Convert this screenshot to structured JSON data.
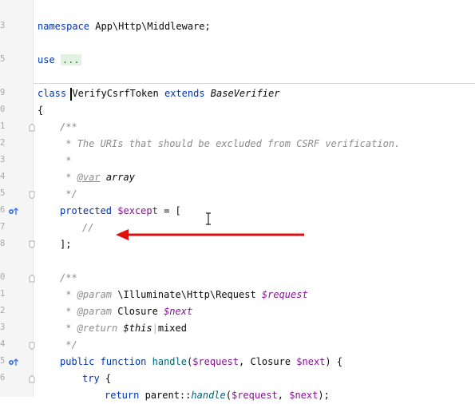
{
  "gutter": {
    "line_numbers": [
      "3",
      "",
      "5",
      "",
      "",
      "",
      "9",
      "0",
      "1",
      "2",
      "3",
      "4",
      "5",
      "6",
      "7",
      "8",
      "",
      "0",
      "1",
      "2",
      "3",
      "4",
      "5",
      "6"
    ]
  },
  "code": {
    "l_namespace_kw": "namespace",
    "l_namespace_path": "App\\Http\\Middleware;",
    "l_use_kw": "use",
    "l_use_fold": "...",
    "l_class_kw": "class",
    "l_class_name": "VerifyCsrfToken",
    "l_extends_kw": "extends",
    "l_base": "BaseVerifier",
    "l_open_brace": "{",
    "l_doc_open": "/**",
    "l_doc_desc": " * The URIs that should be excluded from CSRF verification.",
    "l_doc_star": " *",
    "l_doc_var_star": " * ",
    "l_doc_var_tag": "@var",
    "l_doc_var_type": " array",
    "l_doc_close": " */",
    "l_protected_kw": "protected",
    "l_except_var": "$except",
    "l_except_rest": " = [",
    "l_comment": "//",
    "l_close_arr": "];",
    "l_doc2_open": "/**",
    "l_param1_star": " * ",
    "l_param1_tag": "@param",
    "l_param1_type": " \\Illuminate\\Http\\Request ",
    "l_param1_var": "$request",
    "l_param2_star": " * ",
    "l_param2_tag": "@param",
    "l_param2_type": " Closure ",
    "l_param2_var": "$next",
    "l_return_star": " * ",
    "l_return_tag": "@return",
    "l_return_this": " $this",
    "l_return_pipe": "|",
    "l_return_mixed": "mixed",
    "l_doc2_close": " */",
    "l_public_kw": "public",
    "l_function_kw": "function",
    "l_handle_fn": "handle",
    "l_handle_args_open": "(",
    "l_handle_req": "$request",
    "l_handle_mid": ", Closure ",
    "l_handle_next": "$next",
    "l_handle_close": ") {",
    "l_try_kw": "try",
    "l_try_brace": " {",
    "l_return_kw": "return",
    "l_parent": " parent::",
    "l_handle2": "handle",
    "l_ret_args_open": "(",
    "l_ret_req": "$request",
    "l_ret_sep": ", ",
    "l_ret_next": "$next",
    "l_ret_close": ");"
  },
  "colors": {
    "keyword": "#0033b3",
    "docComment": "#8c8c8c",
    "variable": "#871094",
    "function": "#00627a",
    "arrow": "#e01010",
    "gutterIcon": "#3574f0"
  },
  "icons": [
    "override-up-icon",
    "override-up-icon",
    "fold-marker-icon",
    "text-cursor-icon",
    "red-arrow-annotation"
  ]
}
